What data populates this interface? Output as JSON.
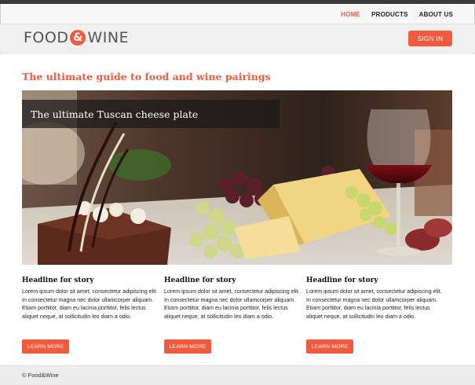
{
  "nav": {
    "items": [
      {
        "label": "HOME",
        "active": true
      },
      {
        "label": "PRODUCTS",
        "active": false
      },
      {
        "label": "ABOUT US",
        "active": false
      }
    ]
  },
  "brand": {
    "logo_left": "FOOD",
    "logo_amp": "&",
    "logo_right": "WINE",
    "accent_color": "#f05a3d"
  },
  "header": {
    "signin_label": "SIGN IN"
  },
  "page": {
    "tagline": "The ultimate guide to food and wine pairings"
  },
  "hero": {
    "caption": "The ultimate Tuscan cheese plate"
  },
  "stories": [
    {
      "headline": "Headline for story",
      "body": "Lorem ipsum dolor sit amet, consectetur adipiscing elit. In consectetur magna nec dolor ullamcorper aliquam. Etiam porttitor, diam eu lacinia porttitor, felis lectus aliquet neque, at sollicitudin leo diam a odio.",
      "button_label": "LEARN MORE"
    },
    {
      "headline": "Headline for story",
      "body": "Lorem ipsum dolor sit amet, consectetur adipiscing elit. In consectetur magna nec dolor ullamcorper aliquam. Etiam porttitor, diam eu lacinia porttitor, felis lectus aliquet neque, at sollicitudin leo diam a odio.",
      "button_label": "LEARN MORE"
    },
    {
      "headline": "Headline for story",
      "body": "Lorem ipsum dolor sit amet, consectetur adipiscing elit. In consectetur magna nec dolor ullamcorper aliquam. Etiam porttitor, diam eu lacinia porttitor, felis lectus aliquet neque, at sollicitudin leo diam a odio.",
      "button_label": "LEARN MORE"
    }
  ],
  "footer": {
    "copyright": "© Food&Wine"
  }
}
